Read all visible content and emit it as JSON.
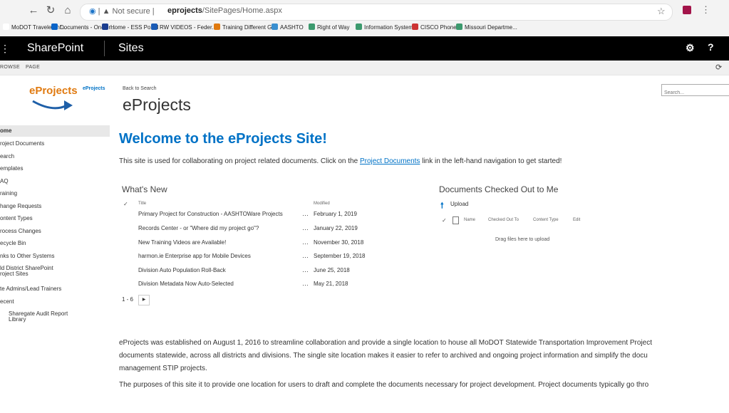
{
  "browser": {
    "security_label": "Not secure",
    "url_host": "eprojects",
    "url_path": "/SitePages/Home.aspx",
    "bookmarks": [
      {
        "label": "MoDOT Traveler Inf...",
        "color": "#ffffff"
      },
      {
        "label": "Documents - OneDr...",
        "color": "#0a64c8"
      },
      {
        "label": "Home - ESS Portal",
        "color": "#1a3d8f"
      },
      {
        "label": "RW VIDEOS - Feder...",
        "color": "#1a5bb5"
      },
      {
        "label": "Training Different G...",
        "color": "#e07a10"
      },
      {
        "label": "AASHTO",
        "color": "#3a8fd0"
      },
      {
        "label": "Right of Way",
        "color": "#3c9a6e"
      },
      {
        "label": "Information System...",
        "color": "#3c9a6e"
      },
      {
        "label": "CISCO Phone",
        "color": "#cc3333"
      },
      {
        "label": "Missouri Departme...",
        "color": "#3c9a6e"
      }
    ]
  },
  "suite": {
    "brand": "SharePoint",
    "sites": "Sites"
  },
  "ribbon": {
    "browse": "ROWSE",
    "page": "PAGE"
  },
  "header": {
    "logo_text": "eProjects",
    "crumb_site": "eProjects",
    "crumb_back": "Back to Search",
    "site_title": "eProjects",
    "search_placeholder": "Search..."
  },
  "leftnav": {
    "items": [
      {
        "label": "ome"
      },
      {
        "label": "roject Documents"
      },
      {
        "label": "earch"
      },
      {
        "label": "emplates"
      },
      {
        "label": "AQ"
      },
      {
        "label": "raining"
      },
      {
        "label": "hange Requests"
      },
      {
        "label": "ontent Types"
      },
      {
        "label": "rocess Changes"
      },
      {
        "label": "ecycle Bin"
      },
      {
        "label": "nks to Other Systems"
      },
      {
        "label": "ld District SharePoint"
      },
      {
        "label": "roject Sites"
      },
      {
        "label": "te Admins/Lead Trainers"
      },
      {
        "label": "ecent"
      },
      {
        "label": "Sharegate Audit Report"
      },
      {
        "label": "Library"
      }
    ]
  },
  "main": {
    "welcome": "Welcome to the eProjects Site!",
    "intro_before": "This site is used for collaborating on project related documents.  Click on the ",
    "intro_link": "Project Documents",
    "intro_after": " link in the left-hand navigation to get started!",
    "whats_new": {
      "title": "What's New",
      "col_title": "Title",
      "col_modified": "Modified",
      "ellipsis": "…",
      "rows": [
        {
          "title": "Primary Project for Construction - AASHTOWare Projects",
          "modified": "February 1, 2019"
        },
        {
          "title": "Records Center - or \"Where did my project go\"?",
          "modified": "January 22, 2019"
        },
        {
          "title": "New Training Videos are Available!",
          "modified": "November 30, 2018"
        },
        {
          "title": "harmon.ie Enterprise app for Mobile Devices",
          "modified": "September 19, 2018"
        },
        {
          "title": "Division Auto Population Roll-Back",
          "modified": "June 25, 2018"
        },
        {
          "title": "Division Metadata Now Auto-Selected",
          "modified": "May 21, 2018"
        }
      ],
      "pager": "1 - 6"
    },
    "checked_out": {
      "title": "Documents Checked Out to Me",
      "upload": "Upload",
      "col_name": "Name",
      "col_checked_out_to": "Checked Out To",
      "col_content_type": "Content Type",
      "col_edit": "Edit",
      "drag_hint": "Drag files here to upload"
    },
    "paragraphs": [
      "eProjects was established on August 1, 2016 to streamline collaboration and provide a single location to house all MoDOT Statewide Transportation Improvement Project",
      "documents statewide, across all districts and divisions.  The single site location makes it easier to refer to archived and ongoing project information and simplify the docu",
      "management STIP projects.",
      "The purposes of this site it to provide one location for users to draft and complete the documents necessary for project development.  Project documents typically go thro"
    ]
  }
}
